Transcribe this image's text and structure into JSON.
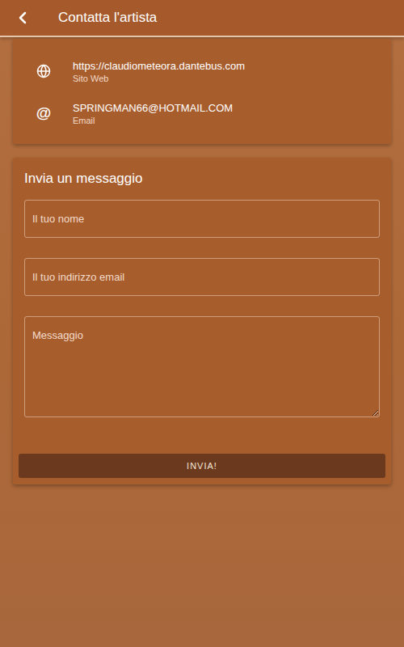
{
  "header": {
    "title": "Contatta l'artista"
  },
  "contacts": [
    {
      "kind": "web",
      "value": "https://claudiometeora.dantebus.com",
      "label": "Sito Web"
    },
    {
      "kind": "email",
      "icon": "@",
      "value": "SPRINGMAN66@HOTMAIL.COM",
      "label": "Email"
    }
  ],
  "form": {
    "title": "Invia un messaggio",
    "fields": [
      {
        "kind": "input",
        "placeholder": "Il tuo nome"
      },
      {
        "kind": "input",
        "placeholder": "Il tuo indirizzo email"
      },
      {
        "kind": "textarea",
        "placeholder": "Messaggio"
      }
    ],
    "button": "INVIA!"
  }
}
